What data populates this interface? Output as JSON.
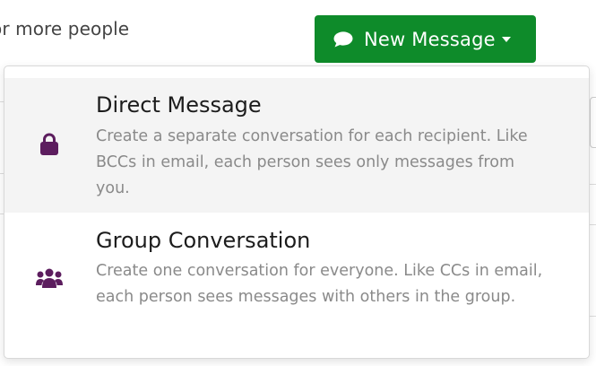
{
  "background": {
    "hint_text": "or more people"
  },
  "new_message_button": {
    "label": "New Message",
    "icon": "comment-icon",
    "caret_icon": "caret-down-icon"
  },
  "dropdown": {
    "options": [
      {
        "title": "Direct Message",
        "description": "Create a separate conversation for each recipient. Like BCCs in email, each person sees only messages from you.",
        "icon": "lock-icon",
        "highlighted": true
      },
      {
        "title": "Group Conversation",
        "description": "Create one conversation for everyone. Like CCs in email, each person sees messages with others in the group.",
        "icon": "users-icon",
        "highlighted": false
      }
    ]
  },
  "colors": {
    "button_green": "#0e8b2a",
    "icon_purple": "#5c1d5e",
    "highlight_bg": "#f4f4f4",
    "title_text": "#1c1c1c",
    "description_text": "#8a8a8a"
  }
}
